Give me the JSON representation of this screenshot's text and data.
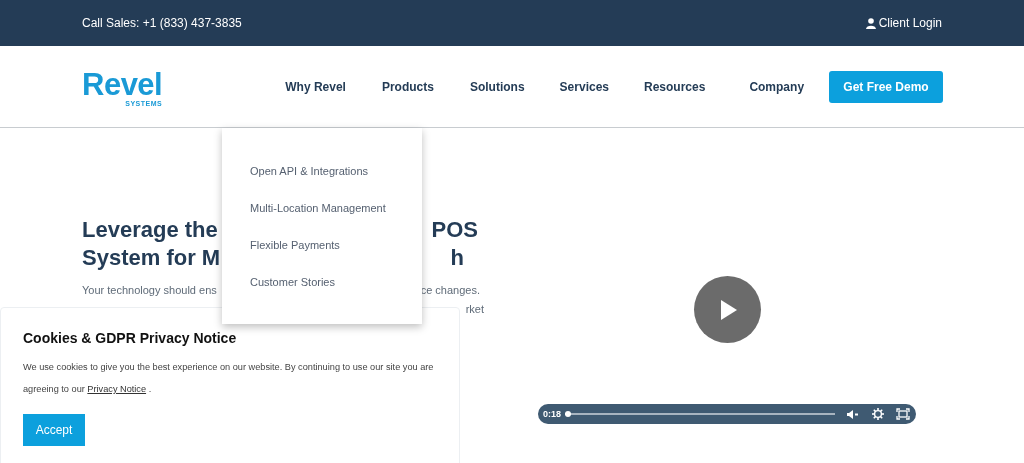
{
  "top_bar": {
    "phone": "Call Sales: +1 (833) 437-3835",
    "client_login": "Client Login"
  },
  "header": {
    "logo": {
      "name": "Revel",
      "tagline": "SYSTEMS"
    },
    "nav": [
      "Why Revel",
      "Products",
      "Solutions",
      "Services",
      "Resources",
      "Company"
    ],
    "dropdown_menu": [
      "Open API & Integrations",
      "Multi-Location Management",
      "Flexible Payments",
      "Customer Stories"
    ],
    "cta": "Get Free Demo"
  },
  "hero": {
    "heading_lines": [
      {
        "left": "Leverage the",
        "right": "POS"
      },
      {
        "left": "System for M",
        "right": "h"
      }
    ],
    "paragraph_lines": [
      {
        "left": "Your technology should ens",
        "right": "ce changes."
      },
      {
        "right": "rket"
      }
    ]
  },
  "video": {
    "time": "0:18",
    "level": 0.01
  },
  "cookie_notice": {
    "title": "Cookies & GDPR Privacy Notice",
    "text": "We use cookies to give you the best experience on our website. By continuing to use our site you are agreeing to our",
    "link": "Privacy Notice",
    "text_end": ".",
    "button": "Accept"
  }
}
